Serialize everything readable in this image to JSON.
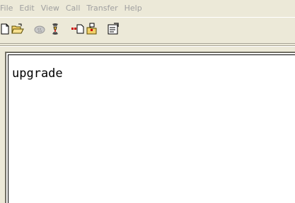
{
  "menubar": {
    "items": [
      {
        "label": "File"
      },
      {
        "label": "Edit"
      },
      {
        "label": "View"
      },
      {
        "label": "Call"
      },
      {
        "label": "Transfer"
      },
      {
        "label": "Help"
      }
    ]
  },
  "toolbar": {
    "buttons": [
      {
        "icon": "new-document-icon"
      },
      {
        "icon": "open-folder-icon"
      },
      {
        "icon": "connect-phone-icon"
      },
      {
        "icon": "disconnect-phone-icon"
      },
      {
        "icon": "send-file-icon"
      },
      {
        "icon": "receive-file-icon"
      },
      {
        "icon": "properties-icon"
      }
    ]
  },
  "terminal": {
    "text": "upgrade"
  },
  "colors": {
    "menu_disabled_text": "#a0a0a0",
    "window_bg": "#ece9d8",
    "terminal_bg": "#ffffff",
    "terminal_text": "#000000"
  }
}
